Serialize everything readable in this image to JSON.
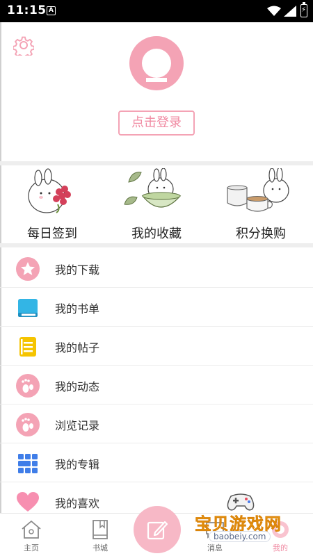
{
  "status_bar": {
    "time": "11:15",
    "notification_badge": "A",
    "battery_glyph": "⚡"
  },
  "header": {
    "login_label": "点击登录",
    "accent_color": "#f4a3b5"
  },
  "quick_actions": [
    {
      "label": "每日签到",
      "icon": "bunny-with-flowers-illustration"
    },
    {
      "label": "我的收藏",
      "icon": "bunny-in-tea-bowl-illustration"
    },
    {
      "label": "积分换购",
      "icon": "bunny-with-teacups-illustration"
    }
  ],
  "menu": [
    {
      "label": "我的下载",
      "icon": "star-icon",
      "color": "#f4a3b5"
    },
    {
      "label": "我的书单",
      "icon": "book-icon",
      "color": "#33b5e5"
    },
    {
      "label": "我的帖子",
      "icon": "note-icon",
      "color": "#f5c400"
    },
    {
      "label": "我的动态",
      "icon": "footprint-icon",
      "color": "#f4a3b5"
    },
    {
      "label": "浏览记录",
      "icon": "footprint-icon",
      "color": "#f4a3b5"
    },
    {
      "label": "我的专辑",
      "icon": "grid-icon",
      "color": "#3f7de8"
    },
    {
      "label": "我的喜欢",
      "icon": "heart-icon",
      "color": "#f78fb0"
    }
  ],
  "tab_bar": {
    "tabs": [
      {
        "label": "主页",
        "icon": "home-icon"
      },
      {
        "label": "书城",
        "icon": "bookmark-book-icon"
      },
      {
        "label": "消息",
        "icon": "message-icon"
      },
      {
        "label": "我的",
        "icon": "profile-icon"
      }
    ],
    "active_color": "#f08aa2"
  },
  "watermark": {
    "text": "宝贝游戏网",
    "url": "baobeiy.com"
  }
}
